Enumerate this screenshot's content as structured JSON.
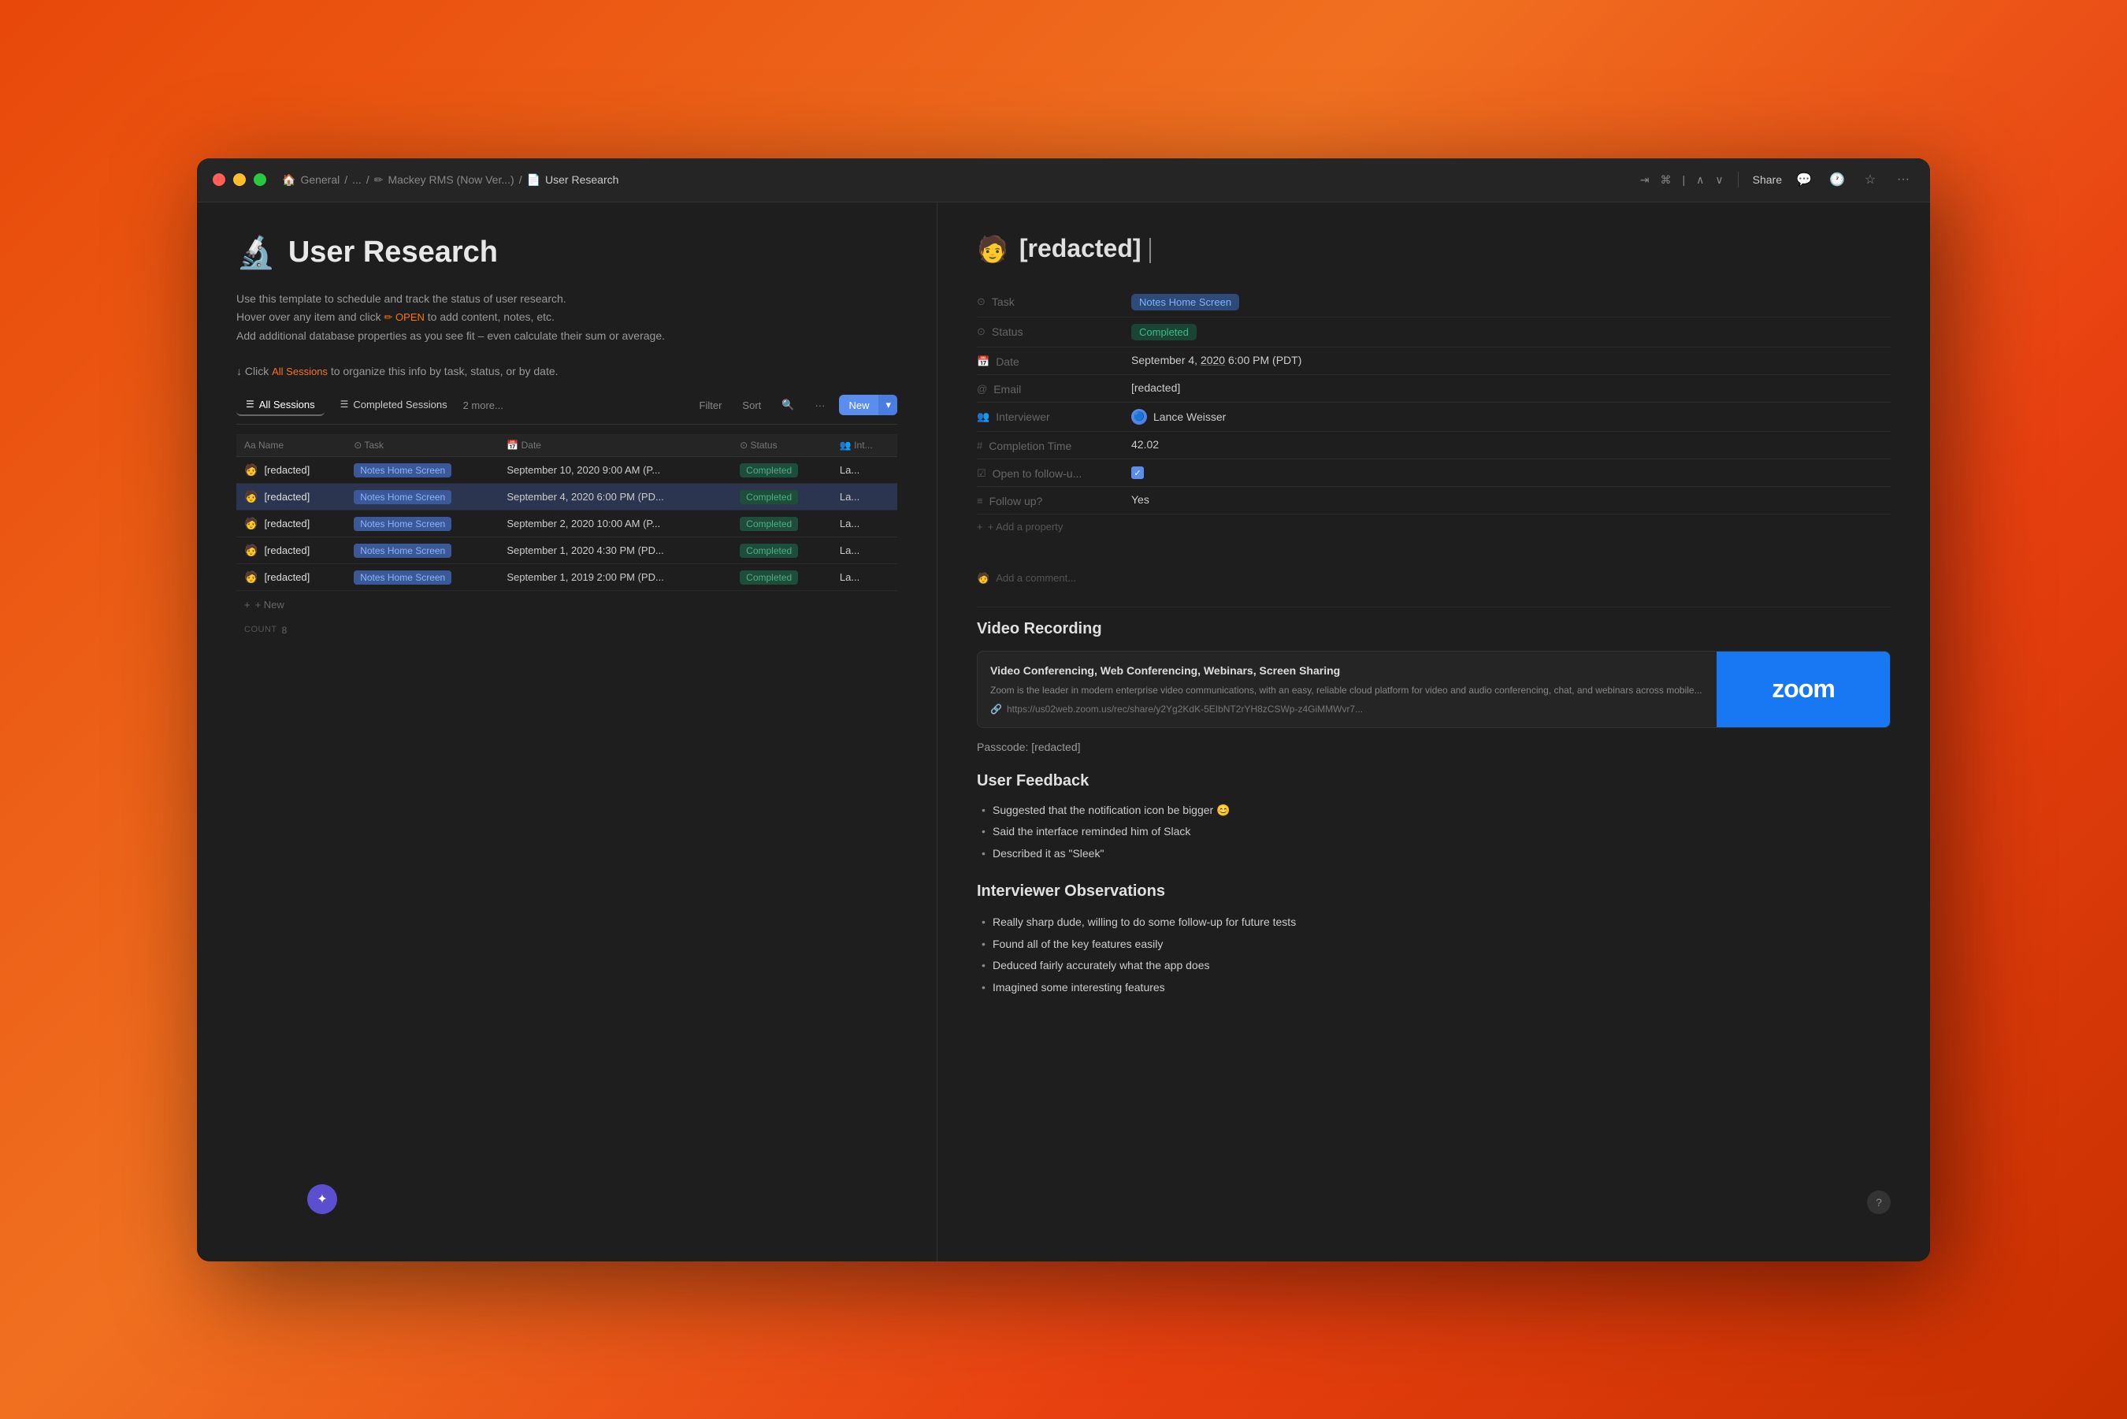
{
  "window": {
    "title": "User Research",
    "traffic_lights": [
      "red",
      "yellow",
      "green"
    ]
  },
  "titlebar": {
    "breadcrumb": {
      "home": "General",
      "sep1": "/",
      "ellipsis": "...",
      "sep2": "/",
      "parent": "Mackey RMS (Now Ver...)",
      "sep3": "/",
      "current": "User Research"
    },
    "share_label": "Share",
    "icons": [
      "comment",
      "clock",
      "star",
      "more"
    ]
  },
  "left_panel": {
    "page_emoji": "🔬",
    "page_title": "User Research",
    "description_line1": "Use this template to schedule and track the status of user research.",
    "description_line2": "Hover over any item and click",
    "description_highlight": "✏ OPEN",
    "description_line2b": "to add content, notes, etc.",
    "description_line3": "Add additional database properties as you see fit – even calculate their sum or average.",
    "click_hint_prefix": "↓ Click",
    "sessions_link": "All Sessions",
    "click_hint_suffix": "to organize this info by task, status, or by date.",
    "tabs": [
      {
        "id": "all-sessions",
        "label": "All Sessions",
        "icon": "☰",
        "active": true
      },
      {
        "id": "completed-sessions",
        "label": "Completed Sessions",
        "icon": "☰",
        "active": false
      }
    ],
    "more_tabs": "2 more...",
    "toolbar": {
      "filter_label": "Filter",
      "sort_label": "Sort",
      "search_icon": "🔍",
      "more_icon": "...",
      "new_label": "New",
      "new_arrow": "▾"
    },
    "table": {
      "columns": [
        "Name",
        "Task",
        "Date",
        "Status",
        "Int..."
      ],
      "rows": [
        {
          "emoji": "🧑",
          "name": "[redacted]",
          "task": "Notes Home Screen",
          "date": "September 10, 2020 9:00 AM (P...",
          "status": "Completed",
          "interviewer": "La...",
          "selected": false
        },
        {
          "emoji": "🧑",
          "name": "[redacted]",
          "task": "Notes Home Screen",
          "date": "September 4, 2020 6:00 PM (PD...",
          "status": "Completed",
          "interviewer": "La...",
          "selected": true
        },
        {
          "emoji": "🧑",
          "name": "[redacted]",
          "task": "Notes Home Screen",
          "date": "September 2, 2020 10:00 AM (P...",
          "status": "Completed",
          "interviewer": "La...",
          "selected": false
        },
        {
          "emoji": "🧑",
          "name": "[redacted]",
          "task": "Notes Home Screen",
          "date": "September 1, 2020 4:30 PM (PD...",
          "status": "Completed",
          "interviewer": "La...",
          "selected": false
        },
        {
          "emoji": "🧑",
          "name": "[redacted]",
          "task": "Notes Home Screen",
          "date": "September 1, 2019 2:00 PM (PD...",
          "status": "Completed",
          "interviewer": "La...",
          "selected": false
        }
      ],
      "add_new_label": "+ New",
      "count_label": "COUNT",
      "count_value": "8"
    }
  },
  "right_panel": {
    "record_emoji": "🧑",
    "record_title": "[redacted]",
    "properties": {
      "task_label": "Task",
      "task_value": "Notes Home Screen",
      "status_label": "Status",
      "status_value": "Completed",
      "date_label": "Date",
      "date_value": "September 4,",
      "date_year": "2020",
      "date_suffix": "6:00 PM (PDT)",
      "email_label": "Email",
      "email_value": "[redacted]",
      "interviewer_label": "Interviewer",
      "interviewer_value": "Lance Weisser",
      "completion_time_label": "Completion Time",
      "completion_time_value": "42.02",
      "open_follow_label": "Open to follow-u...",
      "open_follow_value": true,
      "follow_up_label": "Follow up?",
      "follow_up_value": "Yes",
      "add_property_label": "+ Add a property"
    },
    "add_comment_placeholder": "Add a comment...",
    "video_recording": {
      "section_title": "Video Recording",
      "card_title": "Video Conferencing, Web Conferencing, Webinars, Screen Sharing",
      "card_desc": "Zoom is the leader in modern enterprise video communications, with an easy, reliable cloud platform for video and audio conferencing, chat, and webinars across mobile...",
      "card_link": "https://us02web.zoom.us/rec/share/y2Yg2KdK-5EIbNT2rYH8zCSWp-z4GiMMWvr7...",
      "zoom_logo": "zoom",
      "passcode_label": "Passcode: [redacted]"
    },
    "user_feedback": {
      "section_title": "User Feedback",
      "items": [
        "Suggested that the notification icon be bigger 😊",
        "Said the interface reminded him of Slack",
        "Described it as \"Sleek\""
      ]
    },
    "interviewer_observations": {
      "section_title": "Interviewer Observations",
      "items": [
        "Really sharp dude, willing to do some follow-up for future tests",
        "Found all of the key features easily",
        "Deduced fairly accurately what the app does",
        "Imagined some interesting features"
      ]
    }
  },
  "sidebar": {
    "toggle_icon": "✦"
  },
  "help": {
    "label": "?"
  }
}
